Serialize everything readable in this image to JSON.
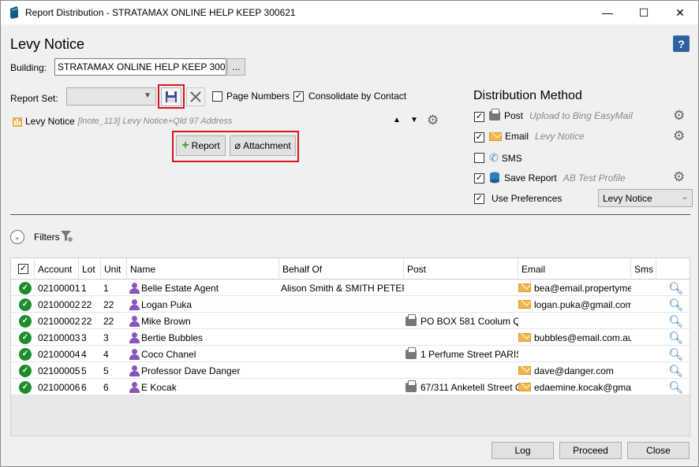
{
  "window": {
    "title": "Report Distribution - STRATAMAX ONLINE HELP KEEP 300621",
    "minimize": "—",
    "maximize": "☐",
    "close": "✕"
  },
  "heading": "Levy Notice",
  "help": "?",
  "building": {
    "label": "Building:",
    "value": "STRATAMAX ONLINE HELP KEEP 300621",
    "browse": "..."
  },
  "report_set": {
    "label": "Report Set:",
    "value": "",
    "save_icon": "save-icon",
    "delete_icon": "close-icon"
  },
  "options": {
    "page_numbers": {
      "label": "Page Numbers",
      "checked": false
    },
    "consolidate": {
      "label": "Consolidate by Contact",
      "checked": true
    }
  },
  "report_item": {
    "name": "Levy Notice",
    "detail": "[lnote_113] Levy Notice+Qld 97 Address"
  },
  "add_buttons": {
    "report": "Report",
    "attachment": "Attachment"
  },
  "distribution": {
    "title": "Distribution Method",
    "post": {
      "label": "Post",
      "detail": "Upload to Bing EasyMail",
      "checked": true
    },
    "email": {
      "label": "Email",
      "detail": "Levy Notice",
      "checked": true
    },
    "sms": {
      "label": "SMS",
      "checked": false
    },
    "save_report": {
      "label": "Save Report",
      "detail": "AB Test Profile",
      "checked": true
    },
    "use_preferences": {
      "label": "Use Preferences",
      "checked": true,
      "value": "Levy Notice"
    }
  },
  "filters": {
    "label": "Filters"
  },
  "table": {
    "columns": [
      "Account",
      "Lot",
      "Unit",
      "Name",
      "Behalf Of",
      "Post",
      "Email",
      "Sms"
    ],
    "rows": [
      {
        "account": "02100001",
        "lot": "1",
        "unit": "1",
        "name": "Belle Estate Agent",
        "behalf": "Alison Smith & SMITH PETER",
        "post": "",
        "email": "bea@email.propertyme"
      },
      {
        "account": "02100002",
        "lot": "22",
        "unit": "22",
        "name": "Logan Puka",
        "behalf": "",
        "post": "",
        "email": "logan.puka@gmail.com"
      },
      {
        "account": "02100002",
        "lot": "22",
        "unit": "22",
        "name": "Mike Brown",
        "behalf": "",
        "post": "PO BOX 581 Coolum Ql",
        "email": ""
      },
      {
        "account": "02100003",
        "lot": "3",
        "unit": "3",
        "name": "Bertie Bubbles",
        "behalf": "",
        "post": "",
        "email": "bubbles@email.com.au"
      },
      {
        "account": "02100004",
        "lot": "4",
        "unit": "4",
        "name": "Coco Chanel",
        "behalf": "",
        "post": "1 Perfume Street PARIS",
        "email": ""
      },
      {
        "account": "02100005",
        "lot": "5",
        "unit": "5",
        "name": "Professor Dave Danger",
        "behalf": "",
        "post": "",
        "email": "dave@danger.com"
      },
      {
        "account": "02100006",
        "lot": "6",
        "unit": "6",
        "name": "E Kocak",
        "behalf": "",
        "post": "67/311 Anketell Street G",
        "email": "edaemine.kocak@gmai"
      }
    ]
  },
  "footer": {
    "log": "Log",
    "proceed": "Proceed",
    "close": "Close"
  }
}
